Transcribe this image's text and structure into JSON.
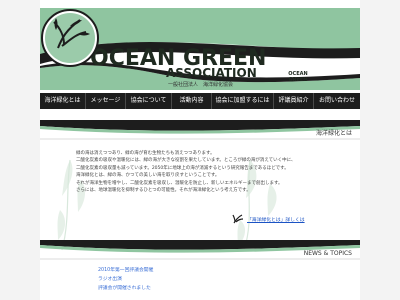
{
  "site": {
    "title": "OCEAN GREEN",
    "subtitle": "ASSOCIATION",
    "japanese_name": "一般社団法人　海洋緑化協会",
    "logo_text_line1": "OCEAN",
    "logo_text_line2": "GREEN"
  },
  "nav": {
    "items": [
      {
        "label": "海洋緑化とは"
      },
      {
        "label": "メッセージ"
      },
      {
        "label": "協会について"
      },
      {
        "label": "活動内容"
      },
      {
        "label": "協会に加盟するには"
      },
      {
        "label": "評議員紹介"
      },
      {
        "label": "お問い合わせ"
      }
    ]
  },
  "section": {
    "title": "海洋緑化とは",
    "paragraphs": [
      "緑の海は消えつつあり、緑の海が育む生物たちも消えつつあります。",
      "二酸化炭素の吸収や温暖化には、緑の海が大きな役割を果たしています。ところが緑の海が消えていく中に、",
      "二酸化炭素の吸収量も減っています。2050年に地球上の海が消滅するという研究報告まであるほどです。",
      "海洋緑化とは、緑の海、かつての美しい海を取り戻すということです。",
      "それが海洋生物を増やし、二酸化炭素を吸収し、温暖化を防止し、新しいエネルギーまで創出します。",
      "さらには、地球温暖化を抑制するひとつの可能性。それが海洋緑化という考え方です。"
    ],
    "more_link": "「海洋緑化とは」詳しくは"
  },
  "news": {
    "title": "NEWS & TOPICS",
    "items": [
      "2010年第一回評議会開催",
      "ラジオ出演",
      "評議会が開催されました"
    ]
  },
  "colors": {
    "green": "#8fc5a0",
    "dark": "#1d1d1d",
    "link": "#1b53c4"
  }
}
